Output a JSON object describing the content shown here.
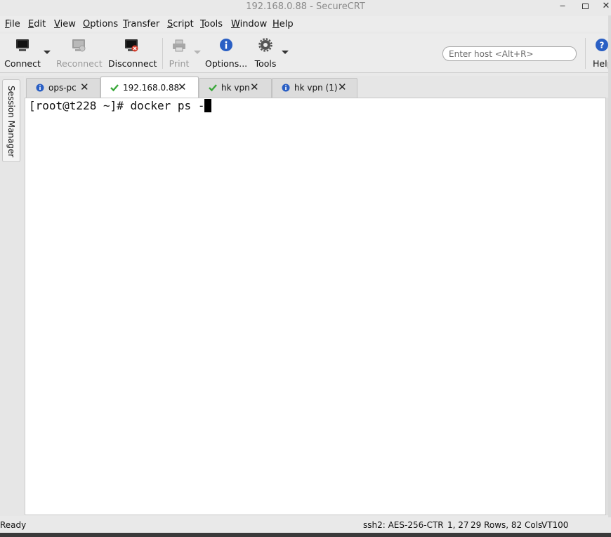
{
  "window": {
    "title": "192.168.0.88 - SecureCRT",
    "controls": {
      "minimize": "‒",
      "close": "✕"
    }
  },
  "menu": {
    "items": [
      {
        "u": "F",
        "rest": "ile"
      },
      {
        "u": "E",
        "rest": "dit"
      },
      {
        "u": "V",
        "rest": "iew"
      },
      {
        "u": "O",
        "rest": "ptions"
      },
      {
        "u": "T",
        "rest": "ransfer"
      },
      {
        "u": "S",
        "rest": "cript"
      },
      {
        "u": "T",
        "rest": "ools"
      },
      {
        "u": "W",
        "rest": "indow"
      },
      {
        "u": "H",
        "rest": "elp"
      }
    ]
  },
  "toolbar": {
    "connect": "Connect",
    "reconnect": "Reconnect",
    "disconnect": "Disconnect",
    "print": "Print",
    "options": "Options...",
    "tools": "Tools",
    "help": "Help",
    "host_placeholder": "Enter host <Alt+R>"
  },
  "sidebar": {
    "session_manager": "Session Manager"
  },
  "tabs": [
    {
      "label": "ops-pc",
      "icon": "info-icon",
      "active": false
    },
    {
      "label": "192.168.0.88",
      "icon": "check-icon",
      "active": true
    },
    {
      "label": "hk vpn",
      "icon": "check-icon",
      "active": false
    },
    {
      "label": "hk vpn (1)",
      "icon": "info-icon",
      "active": false
    }
  ],
  "terminal": {
    "prompt": "[root@t228 ~]# docker ps -"
  },
  "status": {
    "ready": "Ready",
    "cipher": "ssh2: AES-256-CTR",
    "position": "1, 27",
    "size": "29 Rows, 82 Cols",
    "emulation": "VT100"
  },
  "colors": {
    "info_blue": "#2a5fc4",
    "check_green": "#3aa83a",
    "close_red": "#d23b2a"
  }
}
